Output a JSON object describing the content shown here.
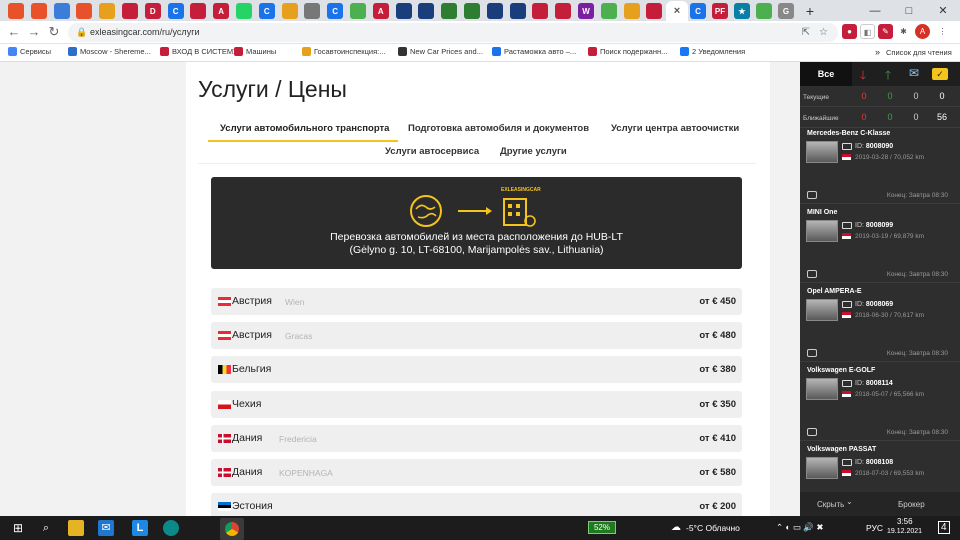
{
  "browser": {
    "tab_icons": [
      {
        "glyph": "",
        "color": "#e8522a"
      },
      {
        "glyph": "",
        "color": "#e8522a"
      },
      {
        "glyph": "",
        "color": "#3b7dd8"
      },
      {
        "glyph": "",
        "color": "#e8522a"
      },
      {
        "glyph": "",
        "color": "#e6a01e"
      },
      {
        "glyph": "",
        "color": "#c41e3a"
      },
      {
        "glyph": "D",
        "color": "#c41e3a"
      },
      {
        "glyph": "C",
        "color": "#1a73e8"
      },
      {
        "glyph": "",
        "color": "#c41e3a"
      },
      {
        "glyph": "A",
        "color": "#c41e3a"
      },
      {
        "glyph": "",
        "color": "#25d366"
      },
      {
        "glyph": "C",
        "color": "#1a73e8"
      },
      {
        "glyph": "",
        "color": "#e6a01e"
      },
      {
        "glyph": "",
        "color": "#777"
      },
      {
        "glyph": "C",
        "color": "#1a73e8"
      },
      {
        "glyph": "",
        "color": "#4caf50"
      },
      {
        "glyph": "A",
        "color": "#c41e3a"
      },
      {
        "glyph": "",
        "color": "#1a3d7c"
      },
      {
        "glyph": "",
        "color": "#1a3d7c"
      },
      {
        "glyph": "",
        "color": "#2e7d32"
      },
      {
        "glyph": "",
        "color": "#2e7d32"
      },
      {
        "glyph": "",
        "color": "#1a3d7c"
      },
      {
        "glyph": "",
        "color": "#1a3d7c"
      },
      {
        "glyph": "",
        "color": "#c41e3a"
      },
      {
        "glyph": "",
        "color": "#c41e3a"
      },
      {
        "glyph": "W",
        "color": "#7b1fa2"
      },
      {
        "glyph": "",
        "color": "#4caf50"
      },
      {
        "glyph": "",
        "color": "#e6a01e"
      },
      {
        "glyph": "",
        "color": "#c41e3a"
      },
      {
        "glyph": "",
        "color": "#e6a01e"
      }
    ],
    "active_tab_close": "×",
    "tab_icons_right": [
      {
        "glyph": "C",
        "color": "#1a73e8"
      },
      {
        "glyph": "PF",
        "color": "#c41e3a"
      },
      {
        "glyph": "★",
        "color": "#0a7ea4"
      },
      {
        "glyph": "",
        "color": "#4caf50"
      },
      {
        "glyph": "G",
        "color": "#888"
      }
    ],
    "new_tab": "+",
    "window_controls": [
      "—",
      "□",
      "✕"
    ],
    "url": "exleasingcar.com/ru/услуги",
    "bookmarks": [
      {
        "label": "Сервисы",
        "color": "#4285f4"
      },
      {
        "label": "Moscow - Shereme...",
        "color": "#2c6ecb"
      },
      {
        "label": "ВХОД В СИСТЕМУ",
        "color": "#c41e3a"
      },
      {
        "label": "Машины",
        "color": "#c41e3a"
      },
      {
        "label": "Госавтоинспекция:...",
        "color": "#e6a01e"
      },
      {
        "label": "New Car Prices and...",
        "color": "#333"
      },
      {
        "label": "Растаможка авто –...",
        "color": "#1a73e8"
      },
      {
        "label": "Поиск подержанн...",
        "color": "#c41e3a"
      },
      {
        "label": "2 Уведомления",
        "color": "#1877f2"
      }
    ],
    "bookmarks_more": "»",
    "reading_list": "Список для чтения"
  },
  "page": {
    "title": "Услуги / Цены",
    "service_tabs": [
      "Услуги автомобильного транспорта",
      "Подготовка автомобиля и документов",
      "Услуги центра автоочистки",
      "Услуги автосервиса",
      "Другие услуги"
    ],
    "banner_logo": "EXLEASINGCAR",
    "banner_line1": "Перевозка автомобилей из места расположения до HUB-LT",
    "banner_line2": "(Gėlyno g. 10, LT-68100, Marijampolės sav., Lithuania)",
    "prices": [
      {
        "country": "Австрия",
        "city": "Wien",
        "price": "от € 450",
        "flag": "at"
      },
      {
        "country": "Австрия",
        "city": "Gracas",
        "price": "от € 480",
        "flag": "at"
      },
      {
        "country": "Бельгия",
        "city": "",
        "price": "от € 380",
        "flag": "be"
      },
      {
        "country": "Чехия",
        "city": "",
        "price": "от € 350",
        "flag": "cz"
      },
      {
        "country": "Дания",
        "city": "Fredericia",
        "price": "от € 410",
        "flag": "dk"
      },
      {
        "country": "Дания",
        "city": "KOPENHAGA",
        "price": "от € 580",
        "flag": "dk"
      },
      {
        "country": "Эстония",
        "city": "",
        "price": "от € 200",
        "flag": "ee"
      }
    ]
  },
  "sidebar": {
    "tab_all": "Все",
    "rows": [
      {
        "label": "Текущие",
        "values": [
          "0",
          "0",
          "0",
          "0"
        ]
      },
      {
        "label": "Ближайшие",
        "values": [
          "0",
          "0",
          "0",
          "56"
        ]
      }
    ],
    "cars": [
      {
        "name": "Mercedes-Benz C-Klasse",
        "id": "8008090",
        "date": "2019-03-28 / 70,052 km",
        "end": "Конец: Завтра 08:30"
      },
      {
        "name": "MINI One",
        "id": "8008099",
        "date": "2019-03-19 / 69,879 km",
        "end": "Конец: Завтра 08:30"
      },
      {
        "name": "Opel AMPERA-E",
        "id": "8008069",
        "date": "2018-06-30 / 70,617 km",
        "end": "Конец: Завтра 08:30"
      },
      {
        "name": "Volkswagen E-GOLF",
        "id": "8008114",
        "date": "2018-05-07 / 65,566 km",
        "end": "Конец: Завтра 08:30"
      },
      {
        "name": "Volkswagen PASSAT",
        "id": "8008108",
        "date": "2018-07-03 / 69,553 km",
        "end": ""
      }
    ],
    "id_prefix": "ID:",
    "hide": "Скрыть",
    "broker": "Брокер"
  },
  "taskbar": {
    "battery": "52%",
    "weather": "-5°C Облачно",
    "lang": "РУС",
    "time": "3:56",
    "date": "19.12.2021",
    "notifications": "4"
  }
}
